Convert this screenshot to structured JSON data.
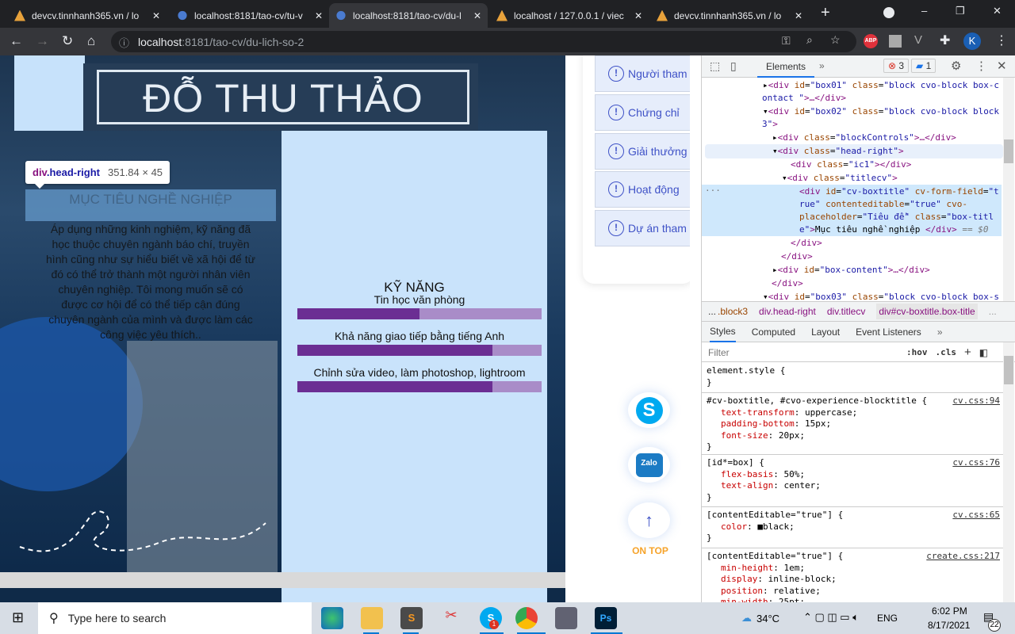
{
  "browser": {
    "tabs": [
      {
        "title": "devcv.tinnhanh365.vn / lo",
        "icon": "phpmyadmin-icon"
      },
      {
        "title": "localhost:8181/tao-cv/tu-v",
        "icon": "site-icon"
      },
      {
        "title": "localhost:8181/tao-cv/du-l",
        "icon": "site-icon",
        "active": true
      },
      {
        "title": "localhost / 127.0.0.1 / viec",
        "icon": "phpmyadmin-icon"
      },
      {
        "title": "devcv.tinnhanh365.vn / lo",
        "icon": "phpmyadmin-icon"
      }
    ],
    "url_host": "localhost",
    "url_rest": ":8181/tao-cv/du-lich-so-2",
    "profile_initial": "K",
    "abp_label": "ABP"
  },
  "cv": {
    "name": "ĐỖ THU THẢO",
    "objective_title": "MỤC TIÊU NGHỀ NGHIỆP",
    "objective_text": "Áp dụng những kinh nghiệm, kỹ năng đã học thuộc chuyên ngành báo chí, truyền hình cũng như sự hiểu biết về xã hội để từ đó có thể trở thành một người nhân viên chuyên nghiệp. Tôi mong muốn sẽ có được cơ hội để có thể tiếp cận đúng chuyên ngành của mình và được làm các công việc yêu thích..",
    "skills_title": "KỸ NĂNG",
    "skills": [
      {
        "name": "Tin học văn phòng",
        "level": 0.5
      },
      {
        "name": "Khả năng giao tiếp bằng tiếng Anh",
        "level": 0.8
      },
      {
        "name": "Chỉnh sửa video, làm photoshop, lightroom",
        "level": 0.8
      }
    ],
    "colors": {
      "bar_fill": "#6b2e93",
      "bar_track": "#a98cc8",
      "panel": "#c9e3fb"
    }
  },
  "inspector_tooltip": {
    "tag": "div",
    "cls": ".head-right",
    "size": "351.84 × 45"
  },
  "sidebar": {
    "items": [
      "Người tham",
      "Chứng chỉ",
      "Giải thưởng",
      "Hoạt động",
      "Dự án tham"
    ]
  },
  "floating": {
    "on_top": "ON TOP",
    "zalo": "Zalo"
  },
  "devtools": {
    "tab": "Elements",
    "errors": "3",
    "messages": "1",
    "breadcrumbs": [
      "...",
      ".block3",
      "div.head-right",
      "div.titlecv",
      "div#cv-boxtitle.box-title",
      "..."
    ],
    "style_tabs": [
      "Styles",
      "Computed",
      "Layout",
      "Event Listeners"
    ],
    "filter_placeholder": "Filter",
    "hov": ":hov",
    "cls": ".cls",
    "rules": [
      {
        "selector": "element.style {",
        "props": [],
        "src": ""
      },
      {
        "selector": "#cv-boxtitle, #cvo-experience-blocktitle {",
        "props": [
          [
            "text-transform",
            "uppercase;"
          ],
          [
            "padding-bottom",
            "15px;"
          ],
          [
            "font-size",
            "20px;"
          ]
        ],
        "src": "cv.css:94"
      },
      {
        "selector": "[id*=box] {",
        "props": [
          [
            "flex-basis",
            "50%;"
          ],
          [
            "text-align",
            "center;"
          ]
        ],
        "src": "cv.css:76"
      },
      {
        "selector": "[contentEditable=\"true\"] {",
        "props": [
          [
            "color",
            "■black;"
          ]
        ],
        "src": "cv.css:65"
      },
      {
        "selector": "[contentEditable=\"true\"] {",
        "props": [
          [
            "min-height",
            "1em;"
          ],
          [
            "display",
            "inline-block;"
          ],
          [
            "position",
            "relative;"
          ],
          [
            "min-width",
            "25pt;"
          ]
        ],
        "src": "create.css:217"
      }
    ]
  },
  "taskbar": {
    "search_placeholder": "Type here to search",
    "weather": "34°C",
    "lang": "ENG",
    "time": "6:02 PM",
    "date": "8/17/2021",
    "notifications": "22",
    "skype_badge": "1"
  }
}
